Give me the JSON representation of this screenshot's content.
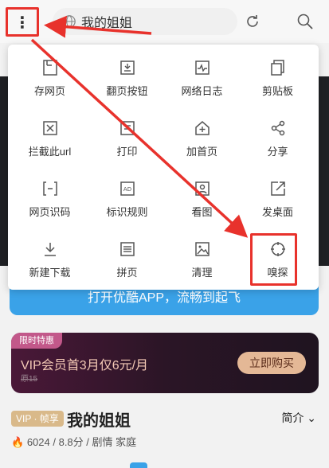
{
  "browser": {
    "url_text": "我的姐姐",
    "menu_glyph": "⋮"
  },
  "menu": {
    "items": [
      {
        "label": "存网页",
        "icon": "save-page-icon"
      },
      {
        "label": "翻页按钮",
        "icon": "page-turn-icon"
      },
      {
        "label": "网络日志",
        "icon": "network-log-icon"
      },
      {
        "label": "剪贴板",
        "icon": "clipboard-icon"
      },
      {
        "label": "拦截此url",
        "icon": "block-url-icon"
      },
      {
        "label": "打印",
        "icon": "print-icon"
      },
      {
        "label": "加首页",
        "icon": "add-home-icon"
      },
      {
        "label": "分享",
        "icon": "share-icon"
      },
      {
        "label": "网页识码",
        "icon": "scan-code-icon"
      },
      {
        "label": "标识规则",
        "icon": "ad-rule-icon"
      },
      {
        "label": "看图",
        "icon": "view-image-icon"
      },
      {
        "label": "发桌面",
        "icon": "send-desktop-icon"
      },
      {
        "label": "新建下载",
        "icon": "download-icon"
      },
      {
        "label": "拼页",
        "icon": "merge-page-icon"
      },
      {
        "label": "清理",
        "icon": "clean-icon"
      },
      {
        "label": "嗅探",
        "icon": "sniff-icon"
      }
    ]
  },
  "page": {
    "open_app_text": "打开优酷APP，流畅到起飞",
    "vip": {
      "tag": "限时特惠",
      "offer": "VIP会员首3月仅6元/月",
      "original_price": "原15",
      "buy_label": "立即购买"
    },
    "show": {
      "badge": "VIP · 帧享",
      "title": "我的姐姐",
      "intro": "简介 ⌄",
      "heat": "6024",
      "meta": "/ 8.8分 / 剧情 家庭"
    }
  },
  "colors": {
    "highlight": "#e8322c",
    "accent_blue": "#3aa2e8"
  }
}
